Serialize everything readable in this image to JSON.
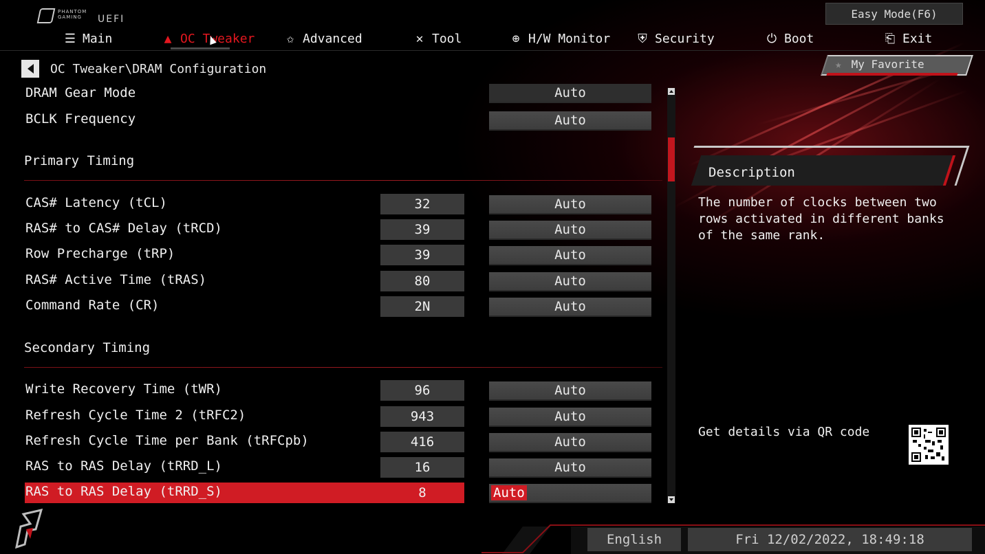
{
  "header": {
    "brand_line1": "PHANTOM",
    "brand_line2": "GAMING",
    "uefi": "UEFI",
    "easy_mode": "Easy Mode(F6)"
  },
  "nav": [
    {
      "label": "Main",
      "icon": "list-icon",
      "glyph": "☰"
    },
    {
      "label": "OC Tweaker",
      "icon": "flame-icon",
      "glyph": "🔥",
      "active": true
    },
    {
      "label": "Advanced",
      "icon": "star-icon",
      "glyph": "✩"
    },
    {
      "label": "Tool",
      "icon": "tools-icon",
      "glyph": "✕"
    },
    {
      "label": "H/W Monitor",
      "icon": "crosshair-icon",
      "glyph": "⊕"
    },
    {
      "label": "Security",
      "icon": "shield-icon",
      "glyph": "⛨"
    },
    {
      "label": "Boot",
      "icon": "power-icon",
      "glyph": "⏻"
    },
    {
      "label": "Exit",
      "icon": "exit-door-icon",
      "glyph": "⎗"
    }
  ],
  "breadcrumb": "OC Tweaker\\DRAM Configuration",
  "my_favorite": "My Favorite",
  "settings": {
    "dram_gear_mode": {
      "label": "DRAM Gear Mode",
      "option": "Auto"
    },
    "bclk_frequency": {
      "label": "BCLK Frequency",
      "option": "Auto"
    }
  },
  "primary": {
    "title": "Primary Timing",
    "rows": [
      {
        "label": "CAS# Latency (tCL)",
        "value": "32",
        "option": "Auto"
      },
      {
        "label": "RAS# to CAS# Delay (tRCD)",
        "value": "39",
        "option": "Auto"
      },
      {
        "label": "Row Precharge (tRP)",
        "value": "39",
        "option": "Auto"
      },
      {
        "label": "RAS# Active Time (tRAS)",
        "value": "80",
        "option": "Auto"
      },
      {
        "label": "Command Rate (CR)",
        "value": "2N",
        "option": "Auto"
      }
    ]
  },
  "secondary": {
    "title": "Secondary Timing",
    "rows": [
      {
        "label": "Write Recovery Time (tWR)",
        "value": "96",
        "option": "Auto"
      },
      {
        "label": "Refresh Cycle Time 2 (tRFC2)",
        "value": "943",
        "option": "Auto"
      },
      {
        "label": "Refresh Cycle Time per Bank (tRFCpb)",
        "value": "416",
        "option": "Auto"
      },
      {
        "label": "RAS to RAS Delay (tRRD_L)",
        "value": "16",
        "option": "Auto"
      },
      {
        "label": "RAS to RAS Delay (tRRD_S)",
        "value": "8",
        "option": "Auto",
        "selected": true
      }
    ]
  },
  "description": {
    "title": "Description",
    "text": "The number of clocks between two rows activated in different banks of the same rank.",
    "qr_label": "Get details via QR code"
  },
  "footer": {
    "language": "English",
    "datetime": "Fri 12/02/2022, 18:49:18"
  },
  "colors": {
    "accent_red": "#d01c24",
    "panel_gray": "#3a3a3a",
    "text": "#f0f0f0"
  }
}
